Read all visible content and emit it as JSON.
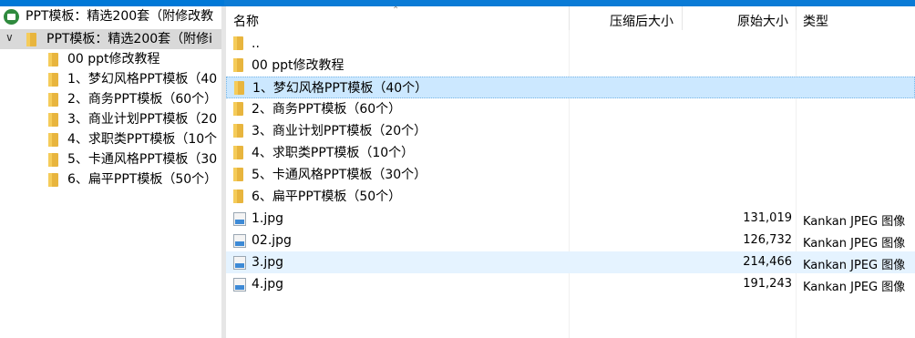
{
  "tree": {
    "root_label": "PPT模板：精选200套（附修改教",
    "expanded_label": "PPT模板：精选200套（附修i",
    "items": [
      {
        "label": "00 ppt修改教程"
      },
      {
        "label": "1、梦幻风格PPT模板（40"
      },
      {
        "label": "2、商务PPT模板（60个）"
      },
      {
        "label": "3、商业计划PPT模板（20"
      },
      {
        "label": "4、求职类PPT模板（10个"
      },
      {
        "label": "5、卡通风格PPT模板（30"
      },
      {
        "label": "6、扁平PPT模板（50个）"
      }
    ]
  },
  "columns": {
    "name": "名称",
    "compressed": "压缩后大小",
    "original": "原始大小",
    "type": "类型"
  },
  "rows": [
    {
      "name": "..",
      "kind": "folder",
      "size": "",
      "type": ""
    },
    {
      "name": "00 ppt修改教程",
      "kind": "folder",
      "size": "",
      "type": ""
    },
    {
      "name": "1、梦幻风格PPT模板（40个）",
      "kind": "folder",
      "size": "",
      "type": "",
      "selected": true
    },
    {
      "name": "2、商务PPT模板（60个）",
      "kind": "folder",
      "size": "",
      "type": ""
    },
    {
      "name": "3、商业计划PPT模板（20个）",
      "kind": "folder",
      "size": "",
      "type": ""
    },
    {
      "name": "4、求职类PPT模板（10个）",
      "kind": "folder",
      "size": "",
      "type": ""
    },
    {
      "name": "5、卡通风格PPT模板（30个）",
      "kind": "folder",
      "size": "",
      "type": ""
    },
    {
      "name": "6、扁平PPT模板（50个）",
      "kind": "folder",
      "size": "",
      "type": ""
    },
    {
      "name": "1.jpg",
      "kind": "image",
      "size": "131,019",
      "type": "Kankan JPEG 图像"
    },
    {
      "name": "02.jpg",
      "kind": "image",
      "size": "126,732",
      "type": "Kankan JPEG 图像"
    },
    {
      "name": "3.jpg",
      "kind": "image",
      "size": "214,466",
      "type": "Kankan JPEG 图像",
      "hover": true
    },
    {
      "name": "4.jpg",
      "kind": "image",
      "size": "191,243",
      "type": "Kankan JPEG 图像"
    }
  ]
}
